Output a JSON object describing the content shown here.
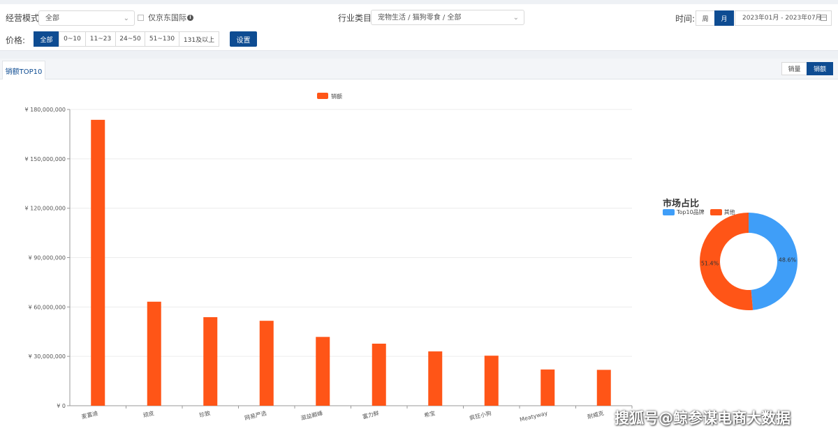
{
  "filters": {
    "mode_label": "经营模式:",
    "mode_value": "全部",
    "jd_intl_label": "仅京东国际",
    "industry_label": "行业类目:",
    "industry_value": "宠物生活 / 猫狗零食 / 全部",
    "time_label": "时间:",
    "time_week": "周",
    "time_month": "月",
    "date_range": "2023年01月 - 2023年07月",
    "price_label": "价格:",
    "price_options": [
      "全部",
      "0~10",
      "11~23",
      "24~50",
      "51~130",
      "131及以上"
    ],
    "settings_button": "设置"
  },
  "tabs": {
    "active": "销额TOP10"
  },
  "metric_toggle": [
    "销量",
    "销额"
  ],
  "colors": {
    "accent": "#0e4c92",
    "bar": "#ff5517",
    "top10": "#3f9ef8",
    "other": "#ff5517"
  },
  "chart_data": [
    {
      "type": "bar",
      "legend": [
        "销额"
      ],
      "categories": [
        "麦富迪",
        "顽皮",
        "珍致",
        "网易严选",
        "滋益巅峰",
        "富力鲜",
        "希宝",
        "疯狂小狗",
        "Meatyway",
        "耐威克"
      ],
      "series": [
        {
          "name": "销额",
          "values": [
            173700000,
            63200000,
            53800000,
            51600000,
            41800000,
            37700000,
            33000000,
            30400000,
            22000000,
            21800000
          ]
        }
      ],
      "ylim": [
        0,
        180000000
      ],
      "yticks": [
        "¥ 0",
        "¥ 30,000,000",
        "¥ 60,000,000",
        "¥ 90,000,000",
        "¥ 120,000,000",
        "¥ 150,000,000",
        "¥ 180,000,000"
      ],
      "grid": true
    },
    {
      "type": "pie",
      "title": "市场占比",
      "legend": [
        "Top10品牌",
        "其他"
      ],
      "values": [
        48.6,
        51.4
      ],
      "labels": [
        "48.6%",
        "51.4%"
      ]
    }
  ],
  "watermark": "搜狐号@鲸参谋电商大数据"
}
